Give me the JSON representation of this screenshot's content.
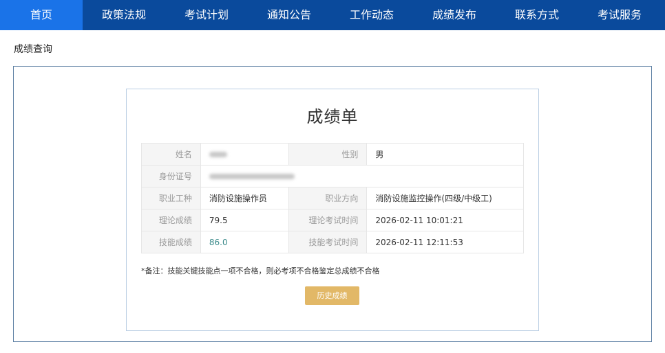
{
  "nav": {
    "items": [
      {
        "label": "首页",
        "active": true
      },
      {
        "label": "政策法规"
      },
      {
        "label": "考试计划"
      },
      {
        "label": "通知公告"
      },
      {
        "label": "工作动态"
      },
      {
        "label": "成绩发布"
      },
      {
        "label": "联系方式"
      },
      {
        "label": "考试服务"
      }
    ]
  },
  "breadcrumb": "成绩查询",
  "report": {
    "title": "成绩单",
    "fields": {
      "name_label": "姓名",
      "gender_label": "性别",
      "gender_value": "男",
      "id_label": "身份证号",
      "occupation_label": "职业工种",
      "occupation_value": "消防设施操作员",
      "direction_label": "职业方向",
      "direction_value": "消防设施监控操作(四级/中级工)",
      "theory_score_label": "理论成绩",
      "theory_score_value": "79.5",
      "theory_time_label": "理论考试时间",
      "theory_time_value": "2026-02-11 10:01:21",
      "skill_score_label": "技能成绩",
      "skill_score_value": "86.0",
      "skill_time_label": "技能考试时间",
      "skill_time_value": "2026-02-11 12:11:53"
    },
    "note": "*备注：技能关键技能点一项不合格，则必考项不合格鉴定总成绩不合格",
    "history_button": "历史成绩"
  },
  "colors": {
    "nav_bg": "#0a4a9c",
    "nav_active": "#1a73e8",
    "button_bg": "#e2b867",
    "skill_score": "#3a8a8a"
  }
}
